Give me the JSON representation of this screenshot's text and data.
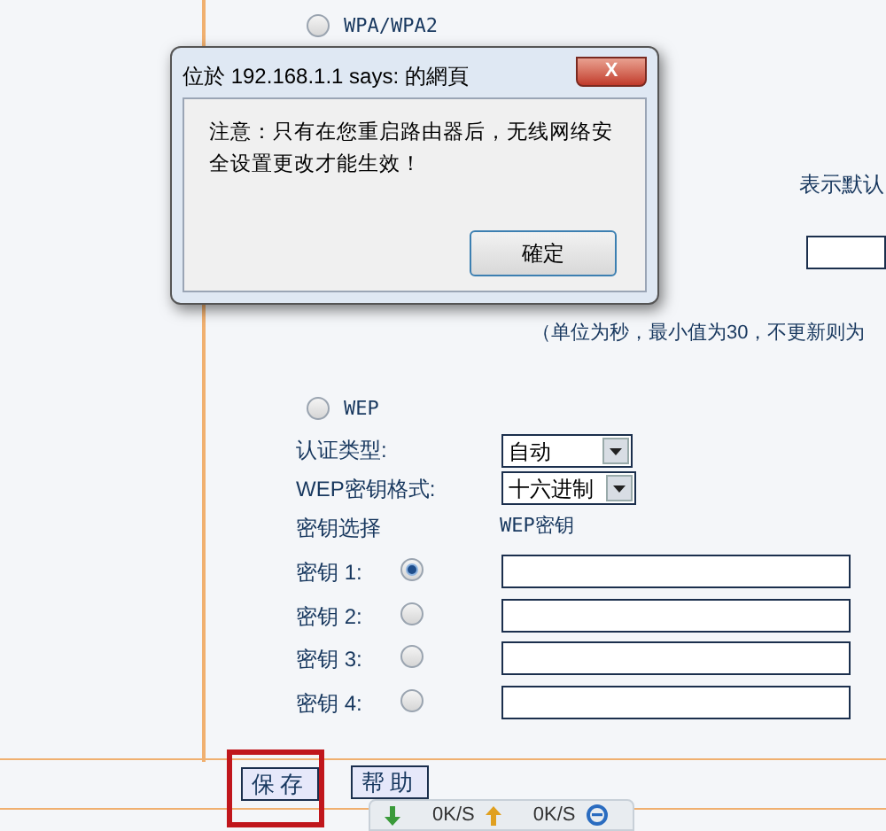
{
  "security_modes": [
    {
      "label": "WPA/WPA2",
      "selected": false
    },
    {
      "label": "WEP",
      "selected": false
    }
  ],
  "partial_texts": {
    "hint_right": "表示默认",
    "update_note": "（单位为秒，最小值为30，不更新则为"
  },
  "wep": {
    "auth_label": "认证类型:",
    "auth_value": "自动",
    "format_label": "WEP密钥格式:",
    "format_value": "十六进制",
    "key_select_heading": "密钥选择",
    "key_heading": "WEP密钥",
    "keys": [
      {
        "label": "密钥 1:",
        "selected": true
      },
      {
        "label": "密钥 2:",
        "selected": false
      },
      {
        "label": "密钥 3:",
        "selected": false
      },
      {
        "label": "密钥 4:",
        "selected": false
      }
    ]
  },
  "buttons": [
    {
      "label": "保存",
      "highlighted": true
    },
    {
      "label": "帮助",
      "highlighted": false
    }
  ],
  "dialog": {
    "title": "位於 192.168.1.1 says: 的網頁",
    "close": "X",
    "message": "注意：只有在您重启路由器后，无线网络安全设置更改才能生效！",
    "ok": "確定"
  },
  "speed_widget": {
    "down": "0K/S",
    "up": "0K/S"
  }
}
